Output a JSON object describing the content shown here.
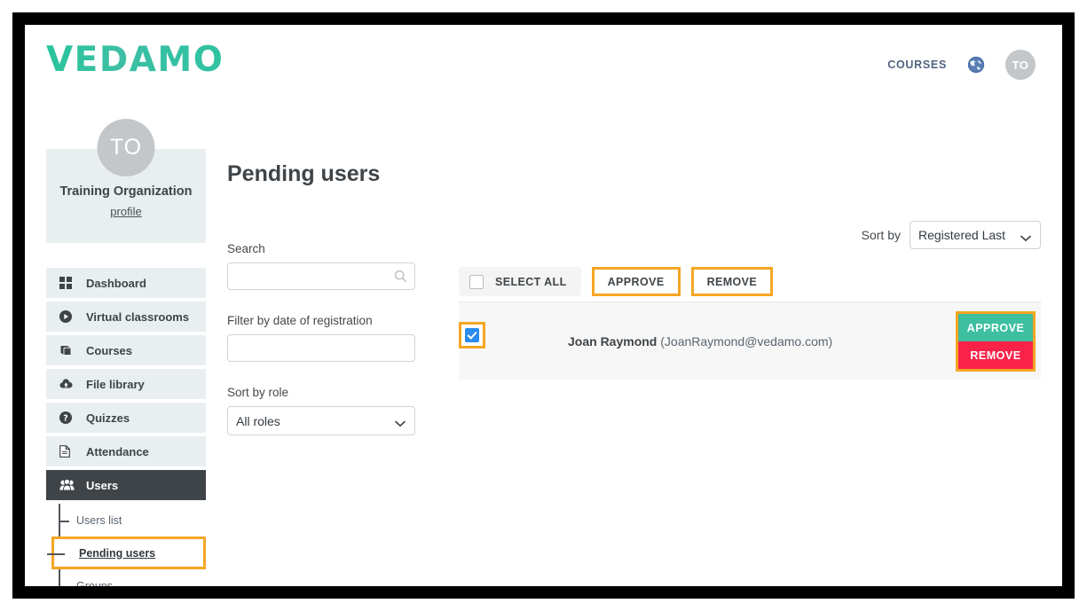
{
  "brand": {
    "logo_text": "VEDAMO",
    "accent_teal": "#2ec4a0",
    "highlight_orange": "#f5a623",
    "danger_red": "#fa2248",
    "checkbox_blue": "#2b8bf0"
  },
  "header": {
    "courses_label": "COURSES",
    "globe_icon": "globe-icon",
    "avatar_initials": "TO"
  },
  "sidebar": {
    "profile": {
      "avatar_initials": "TO",
      "name": "Training Organization",
      "profile_link": "profile"
    },
    "items": [
      {
        "label": "Dashboard",
        "icon": "grid-icon",
        "active": false
      },
      {
        "label": "Virtual classrooms",
        "icon": "play-circle-icon",
        "active": false
      },
      {
        "label": "Courses",
        "icon": "book-icon",
        "active": false
      },
      {
        "label": "File library",
        "icon": "cloud-upload-icon",
        "active": false
      },
      {
        "label": "Quizzes",
        "icon": "question-circle-icon",
        "active": false
      },
      {
        "label": "Attendance",
        "icon": "document-icon",
        "active": false
      },
      {
        "label": "Users",
        "icon": "users-group-icon",
        "active": true
      }
    ],
    "sub_items": [
      {
        "label": "Users list",
        "highlighted": false
      },
      {
        "label": "Pending users",
        "highlighted": true
      },
      {
        "label": "Groups",
        "highlighted": false
      }
    ]
  },
  "main": {
    "title": "Pending users",
    "filters": {
      "search_label": "Search",
      "search_value": "",
      "search_placeholder": "",
      "search_icon": "search-icon",
      "date_label": "Filter by date of registration",
      "date_value": "",
      "date_placeholder": "",
      "role_label": "Sort by role",
      "role_selected": "All roles",
      "role_options": [
        "All roles"
      ]
    },
    "sort": {
      "label": "Sort by",
      "selected": "Registered Last",
      "options": [
        "Registered Last"
      ]
    },
    "toolbar": {
      "select_all_label": "SELECT ALL",
      "select_all_checked": false,
      "approve_label": "APPROVE",
      "remove_label": "REMOVE"
    },
    "users": [
      {
        "checked": true,
        "name": "Joan Raymond",
        "email": "(JoanRaymond@vedamo.com)",
        "approve_label": "APPROVE",
        "remove_label": "REMOVE"
      }
    ]
  }
}
